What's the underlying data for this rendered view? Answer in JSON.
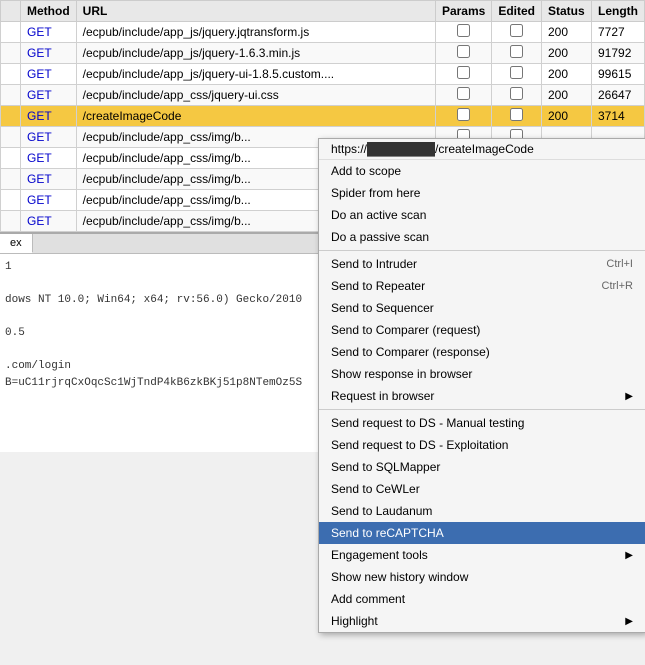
{
  "table": {
    "columns": [
      "",
      "Method",
      "URL",
      "Params",
      "Edited",
      "Status",
      "Length"
    ],
    "rows": [
      {
        "method": "GET",
        "url": "/ecpub/include/app_js/jquery.jqtransform.js",
        "params": false,
        "edited": false,
        "status": "200",
        "length": "7727"
      },
      {
        "method": "GET",
        "url": "/ecpub/include/app_js/jquery-1.6.3.min.js",
        "params": false,
        "edited": false,
        "status": "200",
        "length": "91792"
      },
      {
        "method": "GET",
        "url": "/ecpub/include/app_js/jquery-ui-1.8.5.custom....",
        "params": false,
        "edited": false,
        "status": "200",
        "length": "99615"
      },
      {
        "method": "GET",
        "url": "/ecpub/include/app_css/jquery-ui.css",
        "params": false,
        "edited": false,
        "status": "200",
        "length": "26647"
      },
      {
        "method": "GET",
        "url": "/createImageCode",
        "params": false,
        "edited": false,
        "status": "200",
        "length": "3714",
        "highlighted": true
      },
      {
        "method": "GET",
        "url": "/ecpub/include/app_css/img/b...",
        "params": false,
        "edited": false,
        "status": "",
        "length": ""
      },
      {
        "method": "GET",
        "url": "/ecpub/include/app_css/img/b...",
        "params": false,
        "edited": false,
        "status": "",
        "length": ""
      },
      {
        "method": "GET",
        "url": "/ecpub/include/app_css/img/b...",
        "params": false,
        "edited": false,
        "status": "",
        "length": ""
      },
      {
        "method": "GET",
        "url": "/ecpub/include/app_css/img/b...",
        "params": false,
        "edited": false,
        "status": "",
        "length": ""
      },
      {
        "method": "GET",
        "url": "/ecpub/include/app_css/img/b...",
        "params": false,
        "edited": false,
        "status": "",
        "length": ""
      }
    ]
  },
  "bottom_panel": {
    "tabs": [
      "ex"
    ],
    "content_lines": [
      "1",
      "",
      "dows NT 10.0; Win64; x64; rv:56.0) Gecko/2010",
      "",
      "0.5",
      "",
      ".com/login",
      "B=uC11rjrqCxOqcSc1WjTndP4kB6zkBKj51p8NTemOz5S"
    ]
  },
  "context_menu": {
    "url_display": "https://███████████/createImageCode",
    "items": [
      {
        "label": "Add to scope",
        "shortcut": "",
        "has_arrow": false,
        "separator_before": false
      },
      {
        "label": "Spider from here",
        "shortcut": "",
        "has_arrow": false,
        "separator_before": false
      },
      {
        "label": "Do an active scan",
        "shortcut": "",
        "has_arrow": false,
        "separator_before": false
      },
      {
        "label": "Do a passive scan",
        "shortcut": "",
        "has_arrow": false,
        "separator_before": false
      },
      {
        "label": "Send to Intruder",
        "shortcut": "Ctrl+I",
        "has_arrow": false,
        "separator_before": true
      },
      {
        "label": "Send to Repeater",
        "shortcut": "Ctrl+R",
        "has_arrow": false,
        "separator_before": false
      },
      {
        "label": "Send to Sequencer",
        "shortcut": "",
        "has_arrow": false,
        "separator_before": false
      },
      {
        "label": "Send to Comparer (request)",
        "shortcut": "",
        "has_arrow": false,
        "separator_before": false
      },
      {
        "label": "Send to Comparer (response)",
        "shortcut": "",
        "has_arrow": false,
        "separator_before": false
      },
      {
        "label": "Show response in browser",
        "shortcut": "",
        "has_arrow": false,
        "separator_before": false
      },
      {
        "label": "Request in browser",
        "shortcut": "",
        "has_arrow": true,
        "separator_before": false
      },
      {
        "label": "Send request to DS - Manual testing",
        "shortcut": "",
        "has_arrow": false,
        "separator_before": true
      },
      {
        "label": "Send request to DS - Exploitation",
        "shortcut": "",
        "has_arrow": false,
        "separator_before": false
      },
      {
        "label": "Send to SQLMapper",
        "shortcut": "",
        "has_arrow": false,
        "separator_before": false
      },
      {
        "label": "Send to CeWLer",
        "shortcut": "",
        "has_arrow": false,
        "separator_before": false
      },
      {
        "label": "Send to Laudanum",
        "shortcut": "",
        "has_arrow": false,
        "separator_before": false
      },
      {
        "label": "Send to reCAPTCHA",
        "shortcut": "",
        "has_arrow": false,
        "separator_before": false,
        "selected": true
      },
      {
        "label": "Engagement tools",
        "shortcut": "",
        "has_arrow": true,
        "separator_before": false
      },
      {
        "label": "Show new history window",
        "shortcut": "",
        "has_arrow": false,
        "separator_before": false
      },
      {
        "label": "Add comment",
        "shortcut": "",
        "has_arrow": false,
        "separator_before": false
      },
      {
        "label": "Highlight",
        "shortcut": "",
        "has_arrow": true,
        "separator_before": false
      }
    ]
  }
}
